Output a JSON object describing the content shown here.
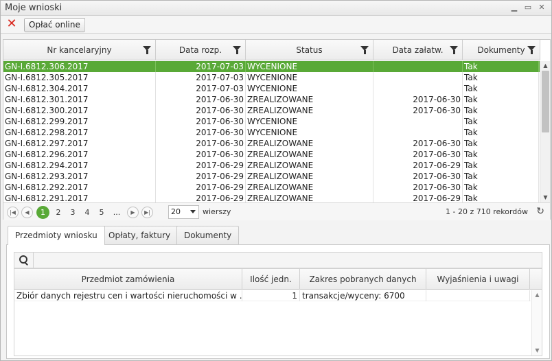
{
  "window": {
    "title": "Moje wnioski"
  },
  "toolbar": {
    "pay_label": "Opłać online"
  },
  "grid": {
    "columns": [
      "Nr kancelaryjny",
      "Data rozp.",
      "Status",
      "Data załatw.",
      "Dokumenty"
    ],
    "rows": [
      [
        "GN-I.6812.306.2017",
        "2017-07-03",
        "WYCENIONE",
        "",
        "Tak"
      ],
      [
        "GN-I.6812.305.2017",
        "2017-07-03",
        "WYCENIONE",
        "",
        "Tak"
      ],
      [
        "GN-I.6812.304.2017",
        "2017-07-03",
        "WYCENIONE",
        "",
        "Tak"
      ],
      [
        "GN-I.6812.301.2017",
        "2017-06-30",
        "ZREALIZOWANE",
        "2017-06-30",
        "Tak"
      ],
      [
        "GN-I.6812.300.2017",
        "2017-06-30",
        "ZREALIZOWANE",
        "2017-06-30",
        "Tak"
      ],
      [
        "GN-I.6812.299.2017",
        "2017-06-30",
        "WYCENIONE",
        "",
        "Tak"
      ],
      [
        "GN-I.6812.298.2017",
        "2017-06-30",
        "WYCENIONE",
        "",
        "Tak"
      ],
      [
        "GN-I.6812.297.2017",
        "2017-06-30",
        "ZREALIZOWANE",
        "2017-06-30",
        "Tak"
      ],
      [
        "GN-I.6812.296.2017",
        "2017-06-30",
        "ZREALIZOWANE",
        "2017-06-30",
        "Tak"
      ],
      [
        "GN-I.6812.294.2017",
        "2017-06-29",
        "ZREALIZOWANE",
        "2017-06-29",
        "Tak"
      ],
      [
        "GN-I.6812.293.2017",
        "2017-06-29",
        "ZREALIZOWANE",
        "2017-06-30",
        "Tak"
      ],
      [
        "GN-I.6812.292.2017",
        "2017-06-29",
        "ZREALIZOWANE",
        "2017-06-30",
        "Tak"
      ],
      [
        "GN-I.6812.291.2017",
        "2017-06-29",
        "ZREALIZOWANE",
        "2017-06-29",
        "Tak"
      ]
    ],
    "selected_row": 0
  },
  "pager": {
    "pages": [
      "1",
      "2",
      "3",
      "4",
      "5",
      "..."
    ],
    "current_page": "1",
    "page_size": "20",
    "page_size_label": "wierszy",
    "info": "1 - 20 z 710 rekordów"
  },
  "tabs": [
    "Przedmioty wniosku",
    "Opłaty, faktury",
    "Dokumenty"
  ],
  "active_tab": 0,
  "subgrid": {
    "columns": [
      "Przedmiot zamówienia",
      "Ilość jedn.",
      "Zakres pobranych danych",
      "Wyjaśnienia i uwagi"
    ],
    "rows": [
      [
        "Zbiór danych rejestru cen i wartości nieruchomości w ...",
        "1",
        "transakcje/wyceny: 6700",
        ""
      ]
    ]
  },
  "colors": {
    "selection": "#59a937",
    "delete": "#d9261c"
  }
}
